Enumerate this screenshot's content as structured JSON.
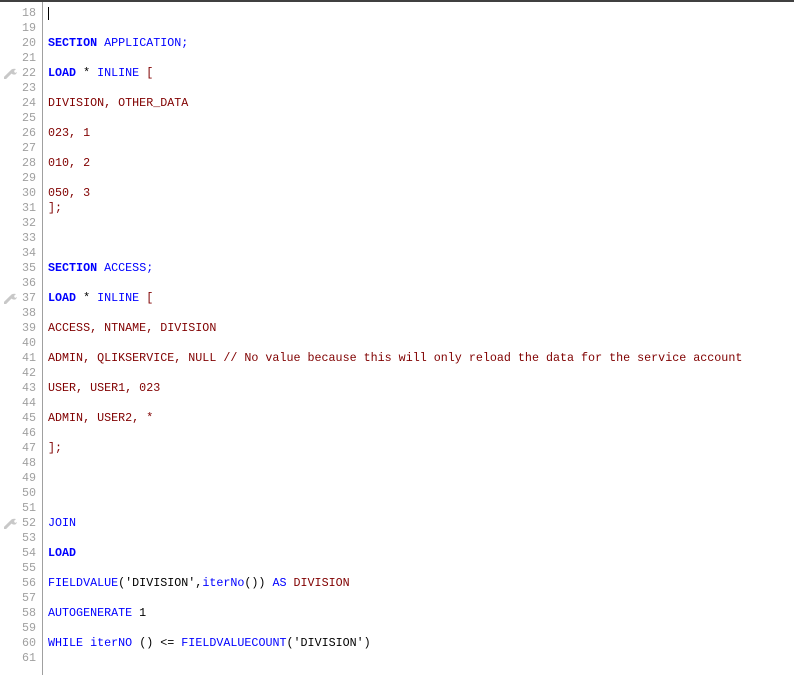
{
  "editor": {
    "cursor_line": 18,
    "colors": {
      "keyword": "#0000ff",
      "identifier": "#800000",
      "plain": "#000000",
      "line_number": "#a0a0a0"
    },
    "lines": [
      {
        "n": "18",
        "tokens": []
      },
      {
        "n": "19",
        "tokens": []
      },
      {
        "n": "20",
        "tokens": [
          [
            "SECTION",
            "kw"
          ],
          [
            " APPLICATION;",
            "fn"
          ]
        ]
      },
      {
        "n": "21",
        "tokens": []
      },
      {
        "n": "22",
        "bookmark": "wrench-icon",
        "tokens": [
          [
            "LOAD",
            "kw"
          ],
          [
            " * ",
            "pl"
          ],
          [
            "INLINE",
            "fn"
          ],
          [
            " [",
            "id"
          ]
        ]
      },
      {
        "n": "23",
        "tokens": []
      },
      {
        "n": "24",
        "tokens": [
          [
            "DIVISION, OTHER_DATA",
            "id"
          ]
        ]
      },
      {
        "n": "25",
        "tokens": []
      },
      {
        "n": "26",
        "tokens": [
          [
            "023, 1",
            "id"
          ]
        ]
      },
      {
        "n": "27",
        "tokens": []
      },
      {
        "n": "28",
        "tokens": [
          [
            "010, 2",
            "id"
          ]
        ]
      },
      {
        "n": "29",
        "tokens": []
      },
      {
        "n": "30",
        "tokens": [
          [
            "050, 3",
            "id"
          ]
        ]
      },
      {
        "n": "31",
        "tokens": [
          [
            "];",
            "id"
          ]
        ]
      },
      {
        "n": "32",
        "tokens": []
      },
      {
        "n": "33",
        "tokens": []
      },
      {
        "n": "34",
        "tokens": []
      },
      {
        "n": "35",
        "tokens": [
          [
            "SECTION",
            "kw"
          ],
          [
            " ACCESS;",
            "fn"
          ]
        ]
      },
      {
        "n": "36",
        "tokens": []
      },
      {
        "n": "37",
        "bookmark": "wrench-icon",
        "tokens": [
          [
            "LOAD",
            "kw"
          ],
          [
            " * ",
            "pl"
          ],
          [
            "INLINE",
            "fn"
          ],
          [
            " [",
            "id"
          ]
        ]
      },
      {
        "n": "38",
        "tokens": []
      },
      {
        "n": "39",
        "tokens": [
          [
            "ACCESS, NTNAME, DIVISION",
            "id"
          ]
        ]
      },
      {
        "n": "40",
        "tokens": []
      },
      {
        "n": "41",
        "tokens": [
          [
            "ADMIN, QLIKSERVICE, NULL // No value because this will only reload the data for the service account",
            "id"
          ]
        ]
      },
      {
        "n": "42",
        "tokens": []
      },
      {
        "n": "43",
        "tokens": [
          [
            "USER, USER1, 023",
            "id"
          ]
        ]
      },
      {
        "n": "44",
        "tokens": []
      },
      {
        "n": "45",
        "tokens": [
          [
            "ADMIN, USER2, *",
            "id"
          ]
        ]
      },
      {
        "n": "46",
        "tokens": []
      },
      {
        "n": "47",
        "tokens": [
          [
            "];",
            "id"
          ]
        ]
      },
      {
        "n": "48",
        "tokens": []
      },
      {
        "n": "49",
        "tokens": []
      },
      {
        "n": "50",
        "tokens": []
      },
      {
        "n": "51",
        "tokens": []
      },
      {
        "n": "52",
        "bookmark": "wrench-icon",
        "tokens": [
          [
            "JOIN",
            "fn"
          ]
        ]
      },
      {
        "n": "53",
        "tokens": []
      },
      {
        "n": "54",
        "tokens": [
          [
            "LOAD",
            "kw"
          ]
        ]
      },
      {
        "n": "55",
        "tokens": []
      },
      {
        "n": "56",
        "tokens": [
          [
            "FIELDVALUE",
            "fn"
          ],
          [
            "('DIVISION',",
            "pl"
          ],
          [
            "iterNo",
            "fn"
          ],
          [
            "())",
            "pl"
          ],
          [
            " AS",
            "fn"
          ],
          [
            " DIVISION",
            "id"
          ]
        ]
      },
      {
        "n": "57",
        "tokens": []
      },
      {
        "n": "58",
        "tokens": [
          [
            "AUTOGENERATE",
            "fn"
          ],
          [
            " 1",
            "pl"
          ]
        ]
      },
      {
        "n": "59",
        "tokens": []
      },
      {
        "n": "60",
        "tokens": [
          [
            "WHILE",
            "fn"
          ],
          [
            " ",
            "pl"
          ],
          [
            "iterNO",
            "fn"
          ],
          [
            " () <= ",
            "pl"
          ],
          [
            "FIELDVALUECOUNT",
            "fn"
          ],
          [
            "('DIVISION')",
            "pl"
          ]
        ]
      },
      {
        "n": "61",
        "tokens": []
      }
    ]
  }
}
